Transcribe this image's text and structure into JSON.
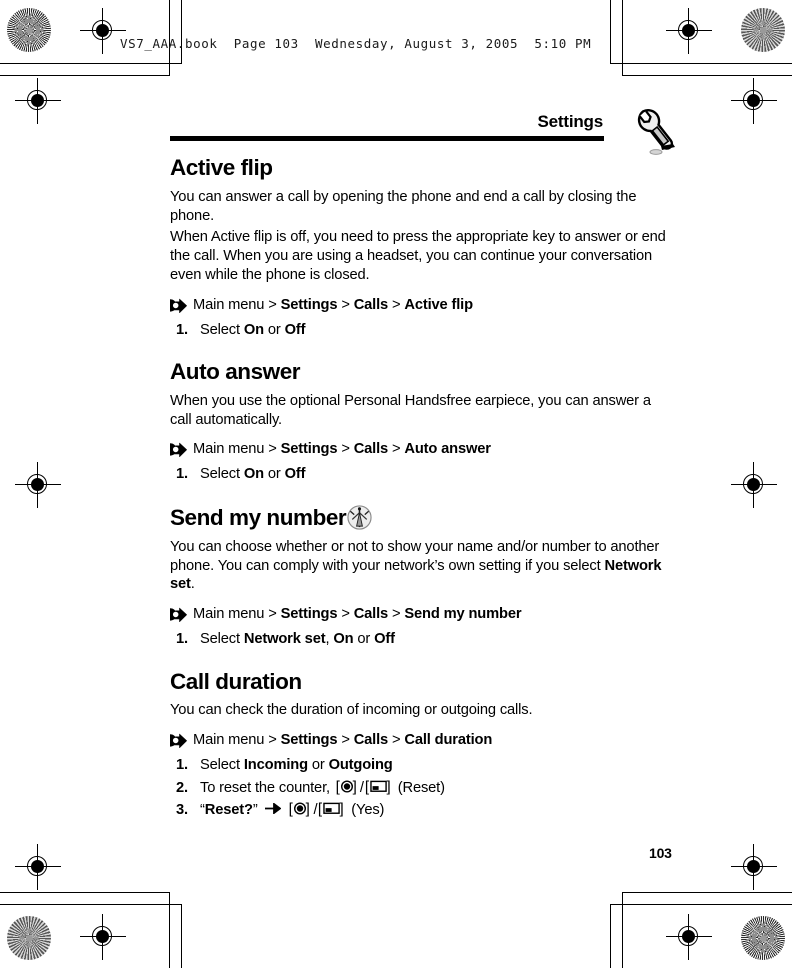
{
  "page": {
    "file_header": "VS7_AAA.book  Page 103  Wednesday, August 3, 2005  5:10 PM",
    "running_head": "Settings",
    "page_number": "103",
    "accent_color": "#000000"
  },
  "icons": {
    "wrench": "wrench-icon",
    "network": "network-antenna-icon",
    "hook_arrow": "hook-arrow-icon",
    "center_key": "center-select-key-icon",
    "left_soft_key": "left-soft-key-icon",
    "right_arrow": "right-arrow-icon"
  },
  "sections": [
    {
      "heading": "Active flip",
      "has_network_icon": false,
      "paragraphs": [
        "You can answer a call by opening the phone and end a call by closing the phone.",
        "When Active flip is off, you need to press the appropriate key to answer or end the call. When you are using a headset, you can continue your conversation even while the phone is closed."
      ],
      "nav": {
        "root": "Main menu",
        "sep": ">",
        "crumbs": [
          "Settings",
          "Calls",
          "Active flip"
        ]
      },
      "steps": [
        {
          "num": "1.",
          "parts": [
            {
              "t": "Select ",
              "b": false
            },
            {
              "t": "On",
              "b": true
            },
            {
              "t": " or ",
              "b": false
            },
            {
              "t": "Off",
              "b": true
            }
          ]
        }
      ]
    },
    {
      "heading": "Auto answer",
      "has_network_icon": false,
      "paragraphs": [
        "When you use the optional Personal Handsfree earpiece, you can answer a call automatically."
      ],
      "nav": {
        "root": "Main menu",
        "sep": ">",
        "crumbs": [
          "Settings",
          "Calls",
          "Auto answer"
        ]
      },
      "steps": [
        {
          "num": "1.",
          "parts": [
            {
              "t": "Select ",
              "b": false
            },
            {
              "t": "On",
              "b": true
            },
            {
              "t": " or ",
              "b": false
            },
            {
              "t": "Off",
              "b": true
            }
          ]
        }
      ]
    },
    {
      "heading": "Send my number",
      "has_network_icon": true,
      "paragraphs": [
        "You can choose whether or not to show your name and/or number to another phone. You can comply with your network’s own setting if you select Network set."
      ],
      "paragraph_bold_terms": [
        "Network set"
      ],
      "nav": {
        "root": "Main menu",
        "sep": ">",
        "crumbs": [
          "Settings",
          "Calls",
          "Send my number"
        ]
      },
      "steps": [
        {
          "num": "1.",
          "parts": [
            {
              "t": "Select ",
              "b": false
            },
            {
              "t": "Network set",
              "b": true
            },
            {
              "t": ", ",
              "b": false
            },
            {
              "t": "On",
              "b": true
            },
            {
              "t": " or ",
              "b": false
            },
            {
              "t": "Off",
              "b": true
            }
          ]
        }
      ]
    },
    {
      "heading": "Call duration",
      "has_network_icon": false,
      "paragraphs": [
        "You can check the duration of incoming or outgoing calls."
      ],
      "nav": {
        "root": "Main menu",
        "sep": ">",
        "crumbs": [
          "Settings",
          "Calls",
          "Call duration"
        ]
      },
      "steps": [
        {
          "num": "1.",
          "parts": [
            {
              "t": "Select ",
              "b": false
            },
            {
              "t": "Incoming",
              "b": true
            },
            {
              "t": " or ",
              "b": false
            },
            {
              "t": "Outgoing",
              "b": true
            }
          ]
        },
        {
          "num": "2.",
          "parts": [
            {
              "t": "To reset the counter, ",
              "b": false
            },
            {
              "key": "center"
            },
            {
              "t": "/",
              "b": false
            },
            {
              "key": "soft"
            },
            {
              "t": " (Reset)",
              "b": false
            }
          ]
        },
        {
          "num": "3.",
          "parts": [
            {
              "t": "“",
              "b": false
            },
            {
              "t": "Reset?",
              "b": true
            },
            {
              "t": "” ",
              "b": false
            },
            {
              "key": "arrow"
            },
            {
              "t": " ",
              "b": false
            },
            {
              "key": "center"
            },
            {
              "t": "/",
              "b": false
            },
            {
              "key": "soft"
            },
            {
              "t": " (Yes)",
              "b": false
            }
          ]
        }
      ]
    }
  ]
}
